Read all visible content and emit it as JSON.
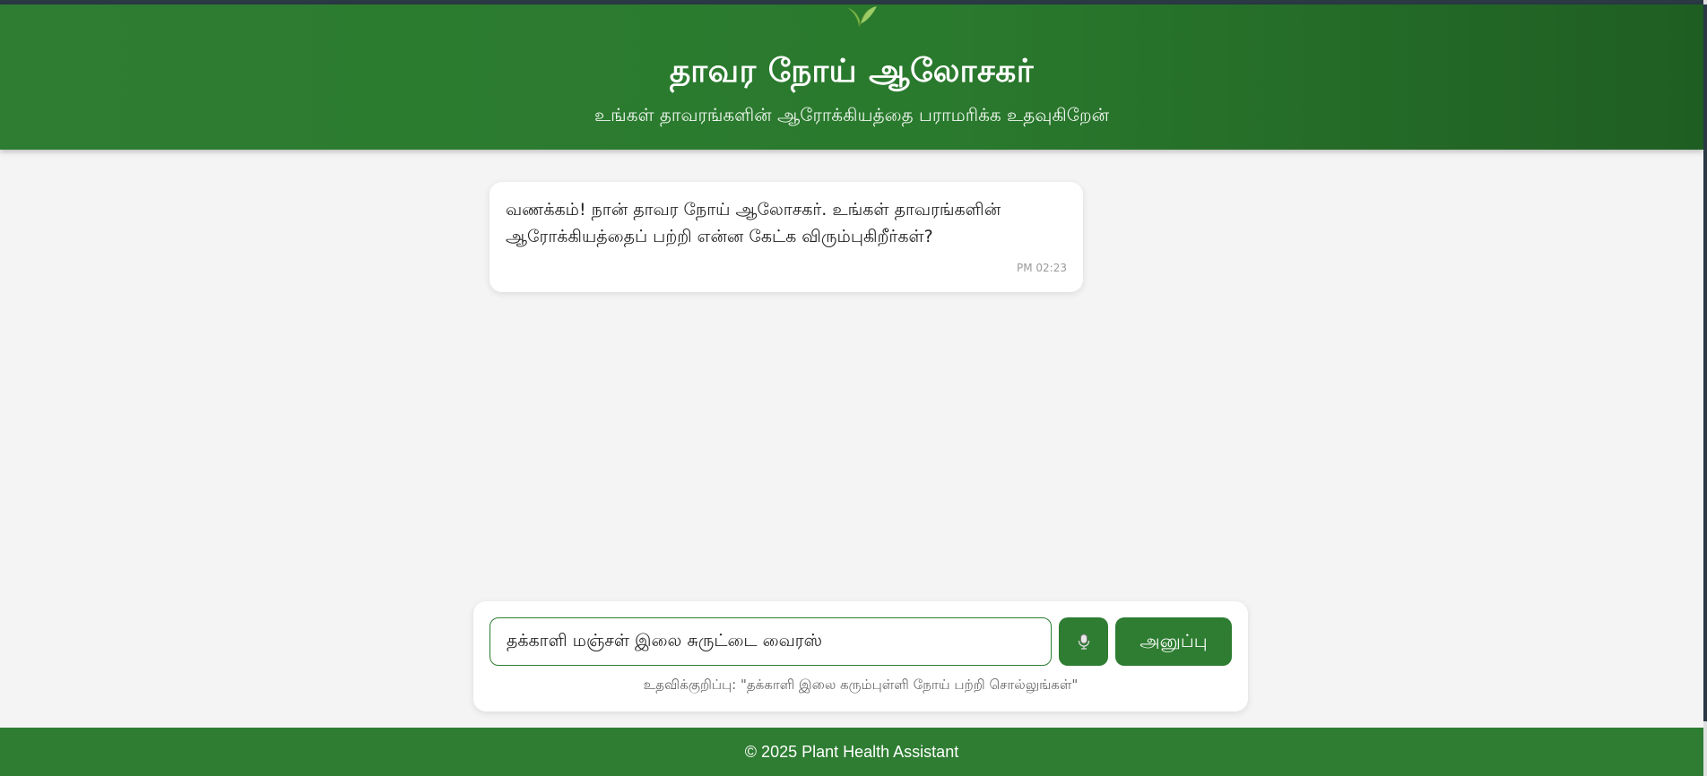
{
  "header": {
    "title": "தாவர நோய் ஆலோசகர்",
    "subtitle": "உங்கள் தாவரங்களின் ஆரோக்கியத்தை பராமரிக்க உதவுகிறேன்",
    "icon": "leaf-icon"
  },
  "chat": {
    "messages": [
      {
        "text": "வணக்கம்! நான் தாவர நோய் ஆலோசகர். உங்கள் தாவரங்களின் ஆரோக்கியத்தைப் பற்றி என்ன கேட்க விரும்புகிறீர்கள்?",
        "time": "PM 02:23"
      }
    ]
  },
  "composer": {
    "input_value": "தக்காளி மஞ்சள் இலை சுருட்டை வைரஸ்",
    "mic_icon": "microphone-icon",
    "send_label": "அனுப்பு",
    "hint": "உதவிக்குறிப்பு: \"தக்காளி இலை கரும்புள்ளி நோய் பற்றி சொல்லுங்கள்\""
  },
  "footer": {
    "text": "© 2025 Plant Health Assistant"
  },
  "colors": {
    "primary": "#2e7d32",
    "header_dark": "#1f5e22",
    "leaf": "#8bc34a",
    "background": "#f4f4f4"
  }
}
